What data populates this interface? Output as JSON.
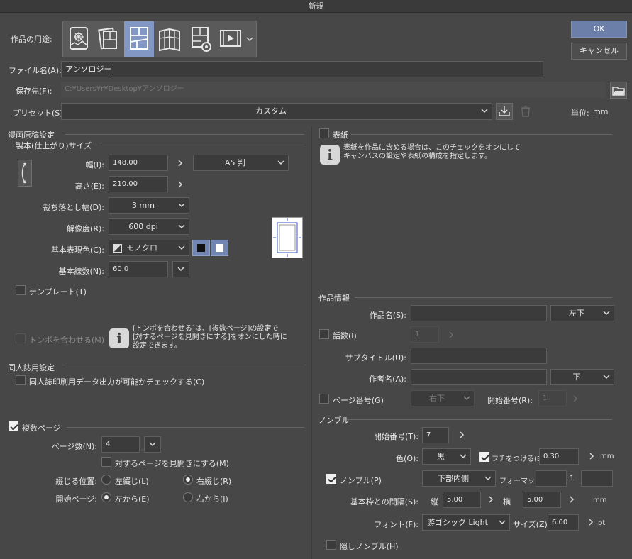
{
  "window": {
    "title": "新規"
  },
  "purpose": {
    "label": "作品の用途:",
    "icons": [
      "illustration-icon",
      "webtoon-icon",
      "comic-icon",
      "fanzine-icon",
      "custom-icon",
      "animation-icon"
    ],
    "selected_index": 2
  },
  "buttons": {
    "ok": "OK",
    "cancel": "キャンセル"
  },
  "filename": {
    "label": "ファイル名(A):",
    "value": "アンソロジー"
  },
  "save_to": {
    "label": "保存先(F):",
    "value": "C:¥Users¥r¥Desktop¥アンソロジー"
  },
  "preset": {
    "label": "プリセット(S):",
    "value": "カスタム",
    "unit_label": "単位:",
    "unit_value": "mm"
  },
  "manga_settings": {
    "title": "漫画原稿設定",
    "finish_size_title": "製本(仕上がり)サイズ",
    "width": {
      "label": "幅(I):",
      "value": "148.00"
    },
    "height": {
      "label": "高さ(E):",
      "value": "210.00"
    },
    "paper_size": "A5 判",
    "bleed": {
      "label": "裁ち落とし幅(D):",
      "value": "3 mm"
    },
    "resolution": {
      "label": "解像度(R):",
      "value": "600 dpi"
    },
    "color_mode": {
      "label": "基本表現色(C):",
      "value": "モノクロ"
    },
    "line_count": {
      "label": "基本線数(N):",
      "value": "60.0"
    },
    "template": {
      "label": "テンプレート(T)",
      "checked": false
    },
    "tombo": {
      "label": "トンボを合わせる(M)",
      "checked": false,
      "info": [
        "[トンボを合わせる]は、[複数ページ]の設定で",
        "[対するページを見開きにする]をオンにした時に",
        "設定できます。"
      ]
    }
  },
  "doujin": {
    "title": "同人誌用設定",
    "check": {
      "label": "同人誌印刷用データ出力が可能かチェックする(C)",
      "checked": false
    }
  },
  "multi_page": {
    "label": "複数ページ",
    "checked": true,
    "page_count": {
      "label": "ページ数(N):",
      "value": "4"
    },
    "spread": {
      "label": "対するページを見開きにする(M)",
      "checked": false
    },
    "binding": {
      "label": "綴じる位置:",
      "left": "左綴じ(L)",
      "right": "右綴じ(R)",
      "selected": "right"
    },
    "start_page": {
      "label": "開始ページ:",
      "left": "左から(E)",
      "right": "右から(I)",
      "selected": "left"
    }
  },
  "cover": {
    "label": "表紙",
    "checked": false,
    "info": [
      "表紙を作品に含める場合は、このチェックをオンにして",
      "キャンバスの設定や表紙の構成を指定します。"
    ]
  },
  "work_info": {
    "title": "作品情報",
    "work_name": {
      "label": "作品名(S):",
      "value": "",
      "position": "左下"
    },
    "episode": {
      "label": "話数(I)",
      "checked": false,
      "value": "1"
    },
    "subtitle": {
      "label": "サブタイトル(U):",
      "value": ""
    },
    "author": {
      "label": "作者名(A):",
      "value": "",
      "position": "下"
    },
    "page_number": {
      "label": "ページ番号(G)",
      "checked": false,
      "position": "右下",
      "start_label": "開始番号(R):",
      "start_value": "1"
    }
  },
  "nombre": {
    "title": "ノンブル",
    "start": {
      "label": "開始番号(T):",
      "value": "7"
    },
    "color": {
      "label": "色(O):",
      "value": "黒"
    },
    "border": {
      "label": "フチをつける(E)",
      "checked": true,
      "value": "0.30",
      "unit": "mm"
    },
    "nombre_check": {
      "label": "ノンブル(P)",
      "checked": true,
      "position": "下部内側",
      "format_label": "フォーマット:",
      "format_prefix": "",
      "format_number": "1",
      "format_suffix": ""
    },
    "gap": {
      "label": "基本枠との間隔(S):",
      "vertical_label": "縦",
      "vertical": "5.00",
      "horizontal_label": "横",
      "horizontal": "5.00",
      "unit": "mm"
    },
    "font": {
      "label": "フォント(F):",
      "value": "游ゴシック Light",
      "size_label": "サイズ(Z):",
      "size": "6.00",
      "unit": "pt"
    },
    "hidden": {
      "label": "隠しノンブル(H)",
      "checked": false
    }
  }
}
